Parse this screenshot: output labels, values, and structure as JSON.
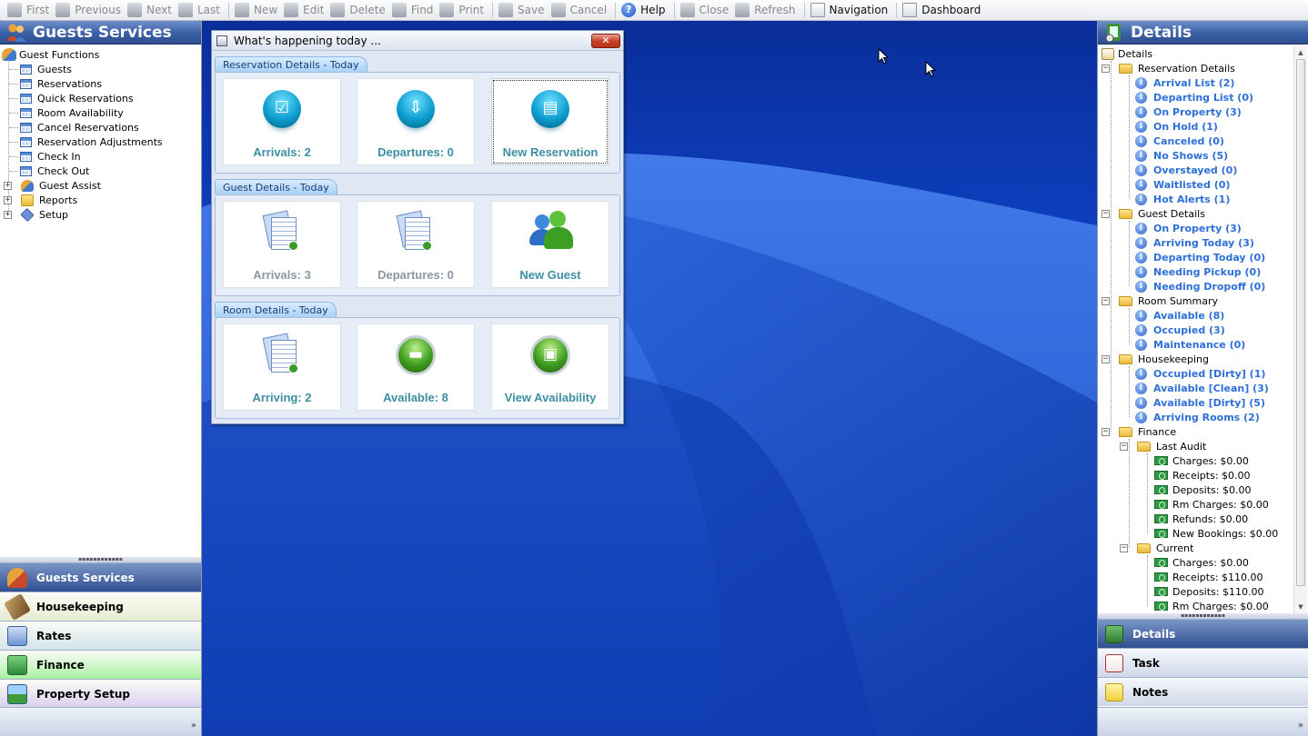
{
  "toolbar": {
    "buttons": [
      {
        "label": "First",
        "icon": "first-icon",
        "enabled": false
      },
      {
        "label": "Previous",
        "icon": "previous-icon",
        "enabled": false
      },
      {
        "label": "Next",
        "icon": "next-icon",
        "enabled": false
      },
      {
        "label": "Last",
        "icon": "last-icon",
        "enabled": false
      },
      {
        "label": "New",
        "icon": "new-icon",
        "enabled": false
      },
      {
        "label": "Edit",
        "icon": "edit-icon",
        "enabled": false
      },
      {
        "label": "Delete",
        "icon": "delete-icon",
        "enabled": false
      },
      {
        "label": "Find",
        "icon": "find-icon",
        "enabled": false
      },
      {
        "label": "Print",
        "icon": "print-icon",
        "enabled": false
      },
      {
        "label": "Save",
        "icon": "save-icon",
        "enabled": false
      },
      {
        "label": "Cancel",
        "icon": "cancel-icon",
        "enabled": false
      },
      {
        "label": "Help",
        "icon": "help-icon",
        "enabled": true
      },
      {
        "label": "Close",
        "icon": "close-icon",
        "enabled": false
      },
      {
        "label": "Refresh",
        "icon": "refresh-icon",
        "enabled": false
      },
      {
        "label": "Navigation",
        "icon": "navigation-icon",
        "enabled": true
      },
      {
        "label": "Dashboard",
        "icon": "dashboard-icon",
        "enabled": true
      }
    ]
  },
  "left_panel": {
    "title": "Guests Services",
    "tree_root": "Guest Functions",
    "tree_items": [
      "Guests",
      "Reservations",
      "Quick Reservations",
      "Room Availability",
      "Cancel Reservations",
      "Reservation Adjustments",
      "Check In",
      "Check Out"
    ],
    "tree_groups": [
      "Guest Assist",
      "Reports",
      "Setup"
    ],
    "nav_buttons": [
      {
        "label": "Guests Services",
        "color": "#c9d6ec"
      },
      {
        "label": "Housekeeping",
        "color": "#e6ecd2"
      },
      {
        "label": "Rates",
        "color": "#d3e4ea"
      },
      {
        "label": "Finance",
        "color": "#a9f0a4"
      },
      {
        "label": "Property Setup",
        "color": "#d9d0f0"
      }
    ]
  },
  "dialog": {
    "title": "What's happening today ...",
    "sections": [
      {
        "tab": "Reservation Details - Today",
        "tiles": [
          {
            "label": "Arrivals: 2"
          },
          {
            "label": "Departures: 0"
          },
          {
            "label": "New Reservation"
          }
        ]
      },
      {
        "tab": "Guest Details - Today",
        "tiles": [
          {
            "label": "Arrivals: 3"
          },
          {
            "label": "Departures: 0"
          },
          {
            "label": "New Guest"
          }
        ]
      },
      {
        "tab": "Room Details - Today",
        "tiles": [
          {
            "label": "Arriving: 2"
          },
          {
            "label": "Available:  8"
          },
          {
            "label": "View Availability"
          }
        ]
      }
    ]
  },
  "right_panel": {
    "title": "Details",
    "tree_root": "Details",
    "groups": [
      {
        "label": "Reservation Details",
        "items": [
          "Arrival List (2)",
          "Departing List (0)",
          "On Property (3)",
          "On Hold (1)",
          "Canceled (0)",
          "No Shows (5)",
          "Overstayed (0)",
          "Waitlisted (0)",
          "Hot Alerts (1)"
        ]
      },
      {
        "label": "Guest Details",
        "items": [
          "On Property (3)",
          "Arriving Today (3)",
          "Departing Today (0)",
          "Needing Pickup (0)",
          "Needing Dropoff (0)"
        ]
      },
      {
        "label": "Room Summary",
        "items": [
          "Available (8)",
          "Occupied (3)",
          "Maintenance (0)"
        ]
      },
      {
        "label": "Housekeeping",
        "items": [
          "Occupied [Dirty] (1)",
          "Available [Clean] (3)",
          "Available [Dirty] (5)",
          "Arriving Rooms (2)"
        ]
      }
    ],
    "finance": {
      "label": "Finance",
      "subgroups": [
        {
          "label": "Last Audit",
          "items": [
            "Charges: $0.00",
            "Receipts: $0.00",
            "Deposits: $0.00",
            "Rm Charges: $0.00",
            "Refunds: $0.00",
            "New Bookings: $0.00"
          ]
        },
        {
          "label": "Current",
          "items": [
            "Charges: $0.00",
            "Receipts: $110.00",
            "Deposits: $110.00",
            "Rm Charges: $0.00"
          ]
        }
      ]
    },
    "nav_buttons": [
      {
        "label": "Details"
      },
      {
        "label": "Task"
      },
      {
        "label": "Notes"
      }
    ]
  }
}
